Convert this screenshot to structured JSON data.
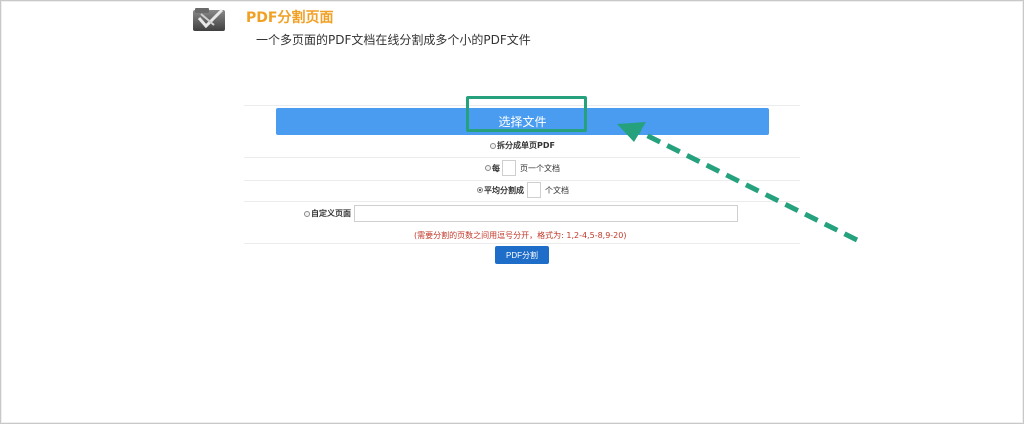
{
  "header": {
    "title": "PDF分割页面",
    "subtitle": "一个多页面的PDF文档在线分割成多个小的PDF文件",
    "logo_icon": "pdf-split-icon"
  },
  "upload": {
    "choose_label": "选择文件"
  },
  "options": {
    "single_page_label": "拆分成单页PDF",
    "every_prefix": "每",
    "every_suffix": "页一个文档",
    "average_prefix": "平均分割成",
    "average_suffix": "个文档",
    "custom_label": "自定义页面"
  },
  "hint_text": "(需要分割的页数之间用逗号分开，格式为: 1,2-4,5-8,9-20)",
  "submit": {
    "label": "PDF分割"
  },
  "colors": {
    "title": "#f0a025",
    "choose_button": "#4a9cf0",
    "split_button": "#1e6ec9",
    "annotation": "#25a17e",
    "hint": "#c0392b"
  },
  "selected_option": "average"
}
